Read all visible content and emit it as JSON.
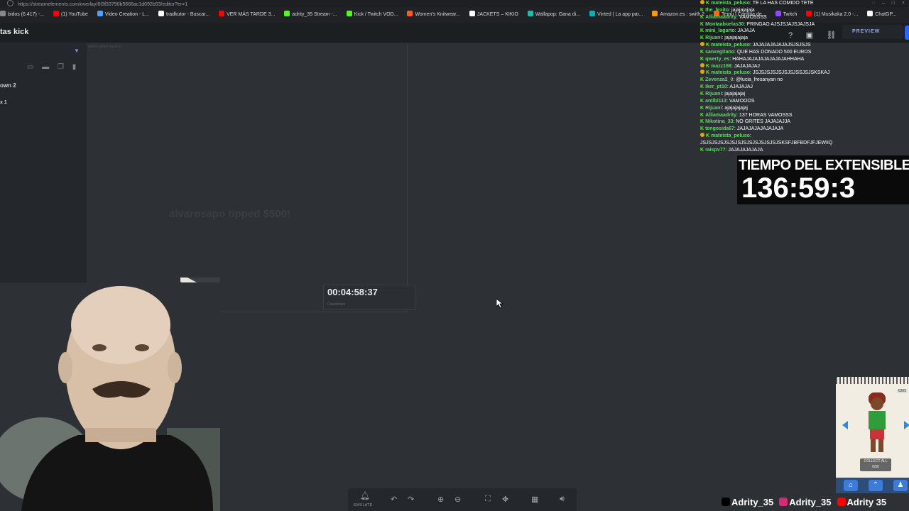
{
  "browser": {
    "url": "https://streamelements.com/overlay/6f3f33790b5666ac1d092b53/editor?er=1",
    "bookmarks": [
      {
        "label": "bidos (6.417) -...",
        "color": "#888"
      },
      {
        "label": "(1) YouTube",
        "color": "#ff0000"
      },
      {
        "label": "Video Creation - L...",
        "color": "#4aa3ff"
      },
      {
        "label": "tradkutor - Buscar...",
        "color": "#ffffff"
      },
      {
        "label": "VER MÁS TARDE 3...",
        "color": "#ff0000"
      },
      {
        "label": "adrity_35 Stream -...",
        "color": "#53fc18"
      },
      {
        "label": "Kick / Twitch VOD...",
        "color": "#53fc18"
      },
      {
        "label": "Women's Knitwear...",
        "color": "#ff5a1f"
      },
      {
        "label": "JACKETS – KIKIO",
        "color": "#ffffff"
      },
      {
        "label": "Wallapop: Gana di...",
        "color": "#13c1ac"
      },
      {
        "label": "Vinted | La app par...",
        "color": "#09b1ba"
      },
      {
        "label": "Amazon.es : swith 2",
        "color": "#ff9900"
      },
      {
        "label": "Temu | Cambia de...",
        "color": "#ff6a00"
      },
      {
        "label": "Twitch",
        "color": "#9146ff"
      },
      {
        "label": "(1) Musikaka 2.0 -...",
        "color": "#ff0000"
      },
      {
        "label": "ChatGP...",
        "color": "#ffffff"
      }
    ]
  },
  "editor": {
    "title": "tas kick",
    "preview_label": "PREVIEW",
    "layers": [
      "own 2",
      "x 1"
    ],
    "canvas_label": "hidden when inactive",
    "tip_text": "alvarosapo",
    "tip_verb": "tipped",
    "tip_amount": "$500!",
    "countdown": "00:04:58:37",
    "countdown_sub": "Countdown"
  },
  "toolbar": {
    "emulate_label": "EMULATE"
  },
  "chat": [
    {
      "user": "mateista_peluso",
      "msg": "TE LA HAS COMIDO TETE",
      "mod": true
    },
    {
      "user": "the_fexito",
      "msg": "jajajajajaja",
      "mod": false
    },
    {
      "user": "Alliamaadrity",
      "msg": "VAMOSSSS",
      "mod": false
    },
    {
      "user": "Montaabuelas30",
      "msg": "PRINGAO AJSJSJAJSJAJSJA",
      "mod": false
    },
    {
      "user": "mini_lagarto",
      "msg": "JAJAJA",
      "mod": false
    },
    {
      "user": "Rijuani",
      "msg": "jajajajajaja",
      "mod": false
    },
    {
      "user": "mateista_peluso",
      "msg": "JAJAJAJAJAJAJSJSJSJS",
      "mod": true
    },
    {
      "user": "sanxegitano",
      "msg": "QUE HAS DONADO 500 EUROS",
      "mod": false
    },
    {
      "user": "qwerty_es",
      "msg": "HAHAJAJAJAJAJAJAJAHHAHA",
      "mod": false
    },
    {
      "user": "mazz166",
      "msg": "JAJAJAJAJ",
      "mod": true
    },
    {
      "user": "mateista_peluso",
      "msg": "JSJSJSJSJSJSJSJSSJSJSKSKAJ",
      "mod": true
    },
    {
      "user": "Zevenza2_0",
      "msg": "@lucia_fresanyan no",
      "mod": false
    },
    {
      "user": "iker_pt10",
      "msg": "AJAJAJAJ",
      "mod": false
    },
    {
      "user": "Rijuani",
      "msg": "jajajajajaj",
      "mod": false
    },
    {
      "user": "antibi113",
      "msg": "VAMOOOS",
      "mod": false
    },
    {
      "user": "Rijuani",
      "msg": "ajajajajajaj",
      "mod": false
    },
    {
      "user": "Alliamaadrity",
      "msg": "137 HORAS VAMOSSS",
      "mod": false
    },
    {
      "user": "Nikotina_33",
      "msg": "NO GRITES JAJAJAJJA",
      "mod": false
    },
    {
      "user": "tengosida67",
      "msg": "JAJAJAJAJAJAJAJA",
      "mod": false
    },
    {
      "user": "mateista_peluso",
      "msg": "",
      "mod": true
    },
    {
      "user": "",
      "msg": "JSJSJSJSJSJSJSJSJSJSJSJSJSJSKSFJBFBDFJFJEWIIQ",
      "mod": false
    },
    {
      "user": "raispv77",
      "msg": "JAJAJAJAJAJA",
      "mod": false
    }
  ],
  "overlay": {
    "timer_title": "TIEMPO DEL EXTENSIBLE:",
    "timer_value": "136:59:3"
  },
  "game": {
    "coins": "6365",
    "collect_label": "COLLECT ALL",
    "collect_count": "0/50"
  },
  "socials": [
    {
      "handle": "Adrity_35",
      "color": "#000000"
    },
    {
      "handle": "Adrity_35",
      "color": "#d62976"
    },
    {
      "handle": "Adrity 35",
      "color": "#ff0000"
    }
  ]
}
